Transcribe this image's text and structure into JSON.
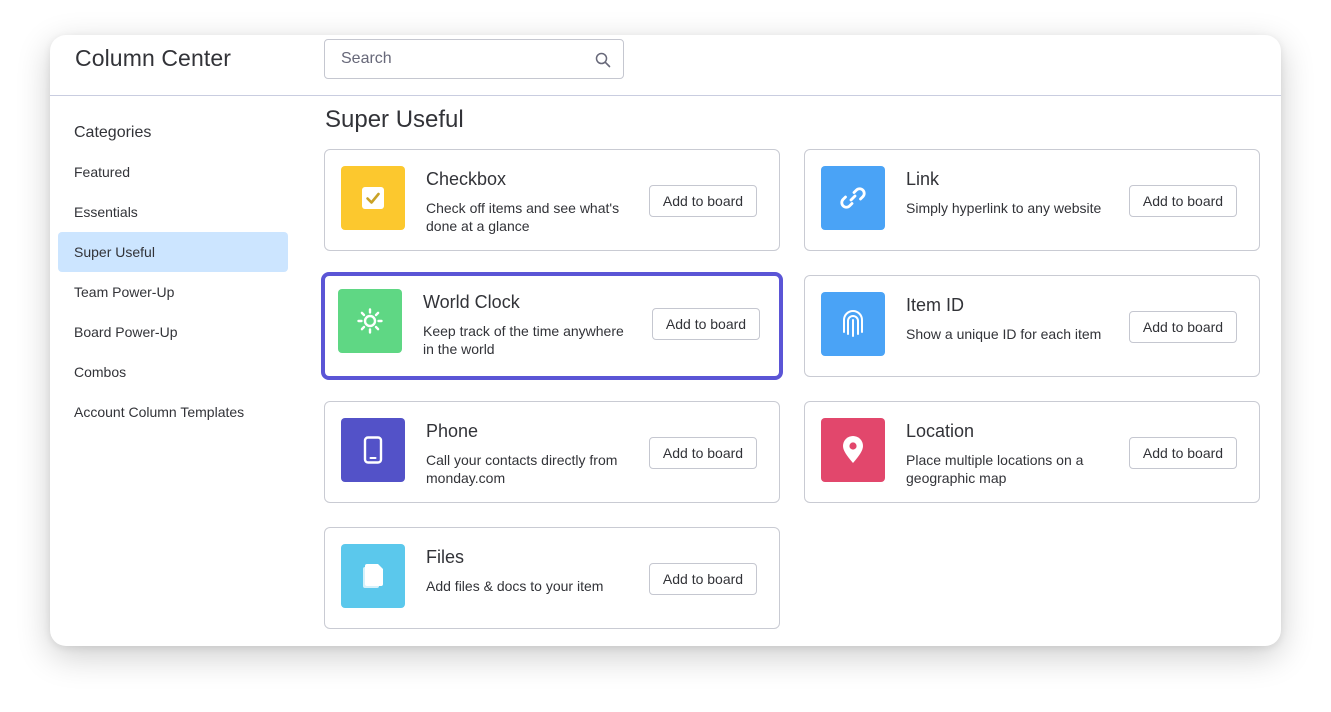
{
  "header": {
    "title": "Column Center",
    "search": {
      "placeholder": "Search",
      "value": "",
      "icon": "search-icon"
    }
  },
  "sidebar": {
    "heading": "Categories",
    "items": [
      {
        "label": "Featured",
        "active": false
      },
      {
        "label": "Essentials",
        "active": false
      },
      {
        "label": "Super Useful",
        "active": true
      },
      {
        "label": "Team Power-Up",
        "active": false
      },
      {
        "label": "Board Power-Up",
        "active": false
      },
      {
        "label": "Combos",
        "active": false
      },
      {
        "label": "Account Column Templates",
        "active": false
      }
    ]
  },
  "main": {
    "section_title": "Super Useful",
    "add_button_label": "Add to board",
    "columns": [
      {
        "title": "Checkbox",
        "description": "Check off items and see what's done at a glance",
        "icon": "checkbox-icon",
        "color": "#fcc82e",
        "selected": false
      },
      {
        "title": "Link",
        "description": "Simply hyperlink to any website",
        "icon": "link-icon",
        "color": "#4aa3f6",
        "selected": false
      },
      {
        "title": "World Clock",
        "description": "Keep track of the time anywhere in the world",
        "icon": "sun-icon",
        "color": "#5fd784",
        "selected": true
      },
      {
        "title": "Item ID",
        "description": "Show a unique ID for each item",
        "icon": "fingerprint-icon",
        "color": "#4aa3f6",
        "selected": false
      },
      {
        "title": "Phone",
        "description": "Call your contacts directly from monday.com",
        "icon": "phone-icon",
        "color": "#5352c8",
        "selected": false
      },
      {
        "title": "Location",
        "description": "Place multiple locations on a geographic map",
        "icon": "location-pin-icon",
        "color": "#e2476c",
        "selected": false
      },
      {
        "title": "Files",
        "description": "Add files & docs to your item",
        "icon": "files-icon",
        "color": "#5bc8ec",
        "selected": false
      }
    ]
  },
  "colors": {
    "accent_selected": "#5b55d6",
    "sidebar_active": "#cce5ff"
  }
}
